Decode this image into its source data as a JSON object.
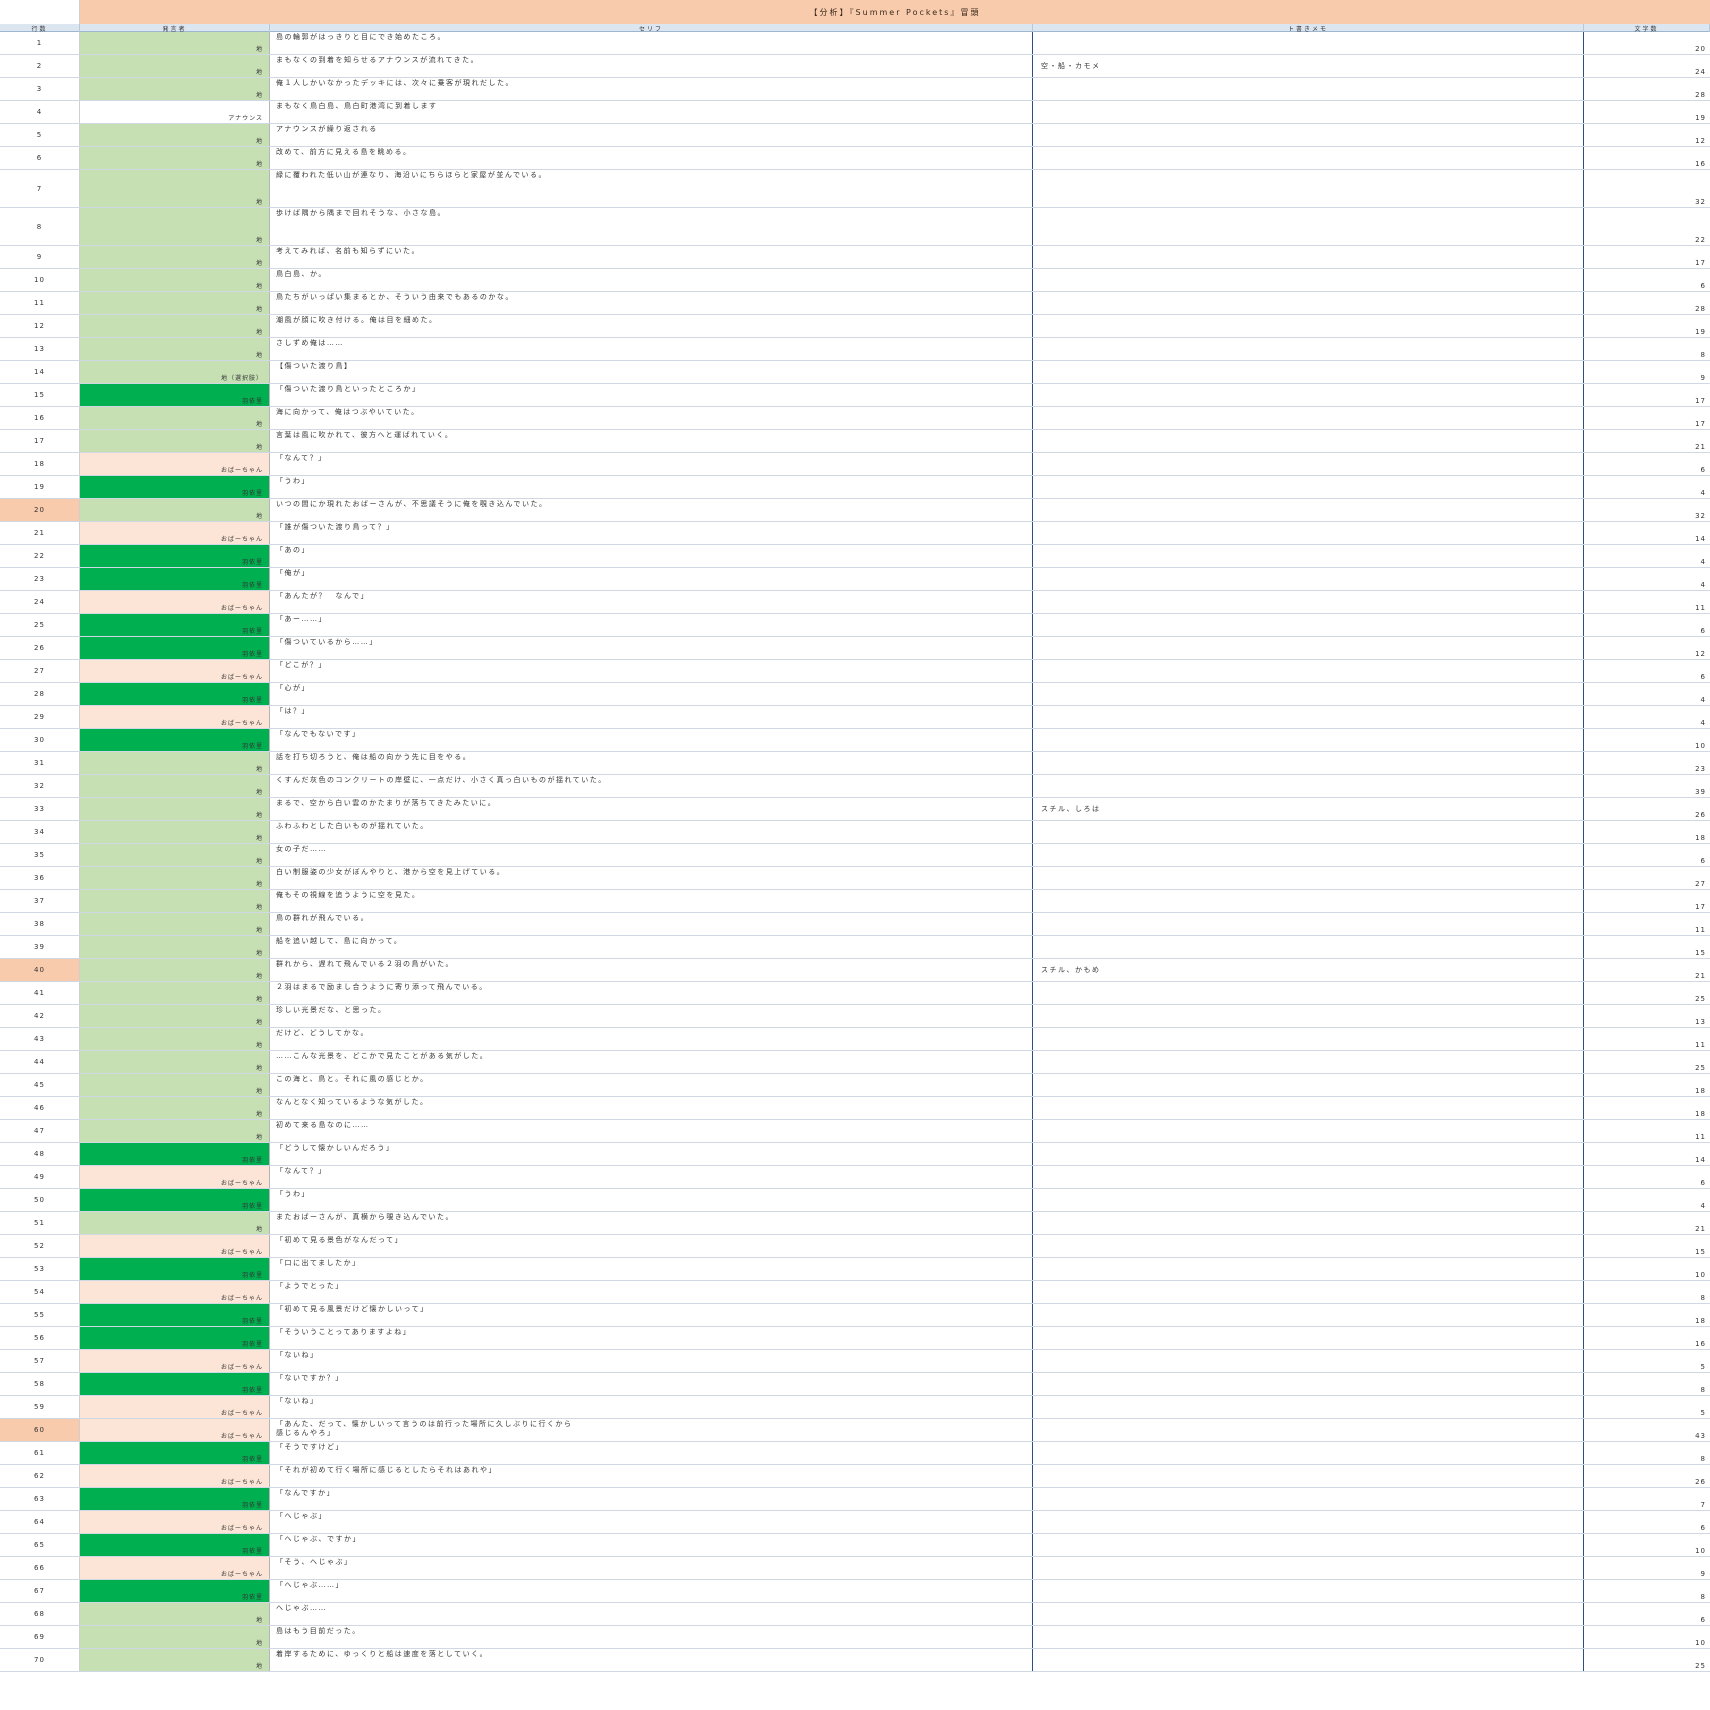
{
  "sheet": {
    "title": "【分析】『Summer Pockets』冒頭",
    "headers": {
      "num": "行数",
      "speaker": "発言者",
      "line": "セリフ",
      "memo": "ト書きメモ",
      "count": "文字数"
    }
  },
  "colors": {
    "narrator": "#c6e0b4",
    "hero": "#00b050",
    "grandma": "#fce4d6",
    "highlight": "#f8cbad"
  },
  "rows": [
    {
      "n": "1",
      "speaker": "地",
      "type": "narr",
      "line": "島の輪郭がはっきりと目にでき始めたころ。",
      "memo": "",
      "count": "20"
    },
    {
      "n": "2",
      "speaker": "地",
      "type": "narr",
      "line": "まもなくの到着を知らせるアナウンスが流れてきた。",
      "memo": "空・船・カモメ",
      "count": "24"
    },
    {
      "n": "3",
      "speaker": "地",
      "type": "narr",
      "line": "俺１人しかいなかったデッキには、次々に乗客が現れだした。",
      "memo": "",
      "count": "28"
    },
    {
      "n": "4",
      "speaker": "アナウンス",
      "type": "other",
      "line": "まもなく鳥白島、鳥白町港湾に到着します",
      "memo": "",
      "count": "19"
    },
    {
      "n": "5",
      "speaker": "地",
      "type": "narr",
      "line": "アナウンスが繰り返される",
      "memo": "",
      "count": "12"
    },
    {
      "n": "6",
      "speaker": "地",
      "type": "narr",
      "line": "改めて、前方に見える島を眺める。",
      "memo": "",
      "count": "16"
    },
    {
      "n": "7",
      "speaker": "地",
      "type": "narr",
      "line": "緑に覆われた低い山が連なり、海沿いにちらほらと家屋が並んでいる。",
      "memo": "",
      "count": "32"
    },
    {
      "n": "8",
      "speaker": "地",
      "type": "narr",
      "line": "歩けば隅から隅まで回れそうな、小さな島。",
      "memo": "",
      "count": "22"
    },
    {
      "n": "9",
      "speaker": "地",
      "type": "narr",
      "line": "考えてみれば、名前も知らずにいた。",
      "memo": "",
      "count": "17"
    },
    {
      "n": "10",
      "speaker": "地",
      "type": "narr",
      "line": "鳥白島、か。",
      "memo": "",
      "count": "6"
    },
    {
      "n": "11",
      "speaker": "地",
      "type": "narr",
      "line": "鳥たちがいっぱい集まるとか、そういう由来でもあるのかな。",
      "memo": "",
      "count": "28"
    },
    {
      "n": "12",
      "speaker": "地",
      "type": "narr",
      "line": "潮風が顔に吹き付ける。俺は目を細めた。",
      "memo": "",
      "count": "19"
    },
    {
      "n": "13",
      "speaker": "地",
      "type": "narr",
      "line": "さしずめ俺は……",
      "memo": "",
      "count": "8"
    },
    {
      "n": "14",
      "speaker": "地（選択肢）",
      "type": "narr",
      "line": "【傷ついた渡り鳥】",
      "memo": "",
      "count": "9"
    },
    {
      "n": "15",
      "speaker": "羽依里",
      "type": "hero",
      "line": "「傷ついた渡り鳥といったところか」",
      "memo": "",
      "count": "17"
    },
    {
      "n": "16",
      "speaker": "地",
      "type": "narr",
      "line": "海に向かって、俺はつぶやいていた。",
      "memo": "",
      "count": "17"
    },
    {
      "n": "17",
      "speaker": "地",
      "type": "narr",
      "line": "言葉は風に吹かれて、彼方へと運ばれていく。",
      "memo": "",
      "count": "21"
    },
    {
      "n": "18",
      "speaker": "おばーちゃん",
      "type": "grandma",
      "line": "「なんて？」",
      "memo": "",
      "count": "6"
    },
    {
      "n": "19",
      "speaker": "羽依里",
      "type": "hero",
      "line": "「うわ」",
      "memo": "",
      "count": "4"
    },
    {
      "n": "20",
      "speaker": "地",
      "type": "narr",
      "line": "いつの間にか現れたおばーさんが、不思議そうに俺を覗き込んでいた。",
      "memo": "",
      "count": "32",
      "hl": true
    },
    {
      "n": "21",
      "speaker": "おばーちゃん",
      "type": "grandma",
      "line": "「誰が傷ついた渡り鳥って？」",
      "memo": "",
      "count": "14"
    },
    {
      "n": "22",
      "speaker": "羽依里",
      "type": "hero",
      "line": "「あの」",
      "memo": "",
      "count": "4"
    },
    {
      "n": "23",
      "speaker": "羽依里",
      "type": "hero",
      "line": "「俺が」",
      "memo": "",
      "count": "4"
    },
    {
      "n": "24",
      "speaker": "おばーちゃん",
      "type": "grandma",
      "line": "「あんたが？　なんで」",
      "memo": "",
      "count": "11"
    },
    {
      "n": "25",
      "speaker": "羽依里",
      "type": "hero",
      "line": "「あー……」",
      "memo": "",
      "count": "6"
    },
    {
      "n": "26",
      "speaker": "羽依里",
      "type": "hero",
      "line": "「傷ついているから……」",
      "memo": "",
      "count": "12"
    },
    {
      "n": "27",
      "speaker": "おばーちゃん",
      "type": "grandma",
      "line": "「どこが？」",
      "memo": "",
      "count": "6"
    },
    {
      "n": "28",
      "speaker": "羽依里",
      "type": "hero",
      "line": "「心が」",
      "memo": "",
      "count": "4"
    },
    {
      "n": "29",
      "speaker": "おばーちゃん",
      "type": "grandma",
      "line": "「は？」",
      "memo": "",
      "count": "4"
    },
    {
      "n": "30",
      "speaker": "羽依里",
      "type": "hero",
      "line": "「なんでもないです」",
      "memo": "",
      "count": "10"
    },
    {
      "n": "31",
      "speaker": "地",
      "type": "narr",
      "line": "話を打ち切ろうと、俺は船の向かう先に目をやる。",
      "memo": "",
      "count": "23"
    },
    {
      "n": "32",
      "speaker": "地",
      "type": "narr",
      "line": "くすんだ灰色のコンクリートの岸壁に、一点だけ、小さく真っ白いものが揺れていた。",
      "memo": "",
      "count": "39"
    },
    {
      "n": "33",
      "speaker": "地",
      "type": "narr",
      "line": "まるで、空から白い雲のかたまりが落ちてきたみたいに。",
      "memo": "スチル、しろは",
      "count": "26"
    },
    {
      "n": "34",
      "speaker": "地",
      "type": "narr",
      "line": "ふわふわとした白いものが揺れていた。",
      "memo": "",
      "count": "18"
    },
    {
      "n": "35",
      "speaker": "地",
      "type": "narr",
      "line": "女の子だ……",
      "memo": "",
      "count": "6"
    },
    {
      "n": "36",
      "speaker": "地",
      "type": "narr",
      "line": "白い制服姿の少女がぼんやりと、港から空を見上げている。",
      "memo": "",
      "count": "27"
    },
    {
      "n": "37",
      "speaker": "地",
      "type": "narr",
      "line": "俺もその視線を追うように空を見た。",
      "memo": "",
      "count": "17"
    },
    {
      "n": "38",
      "speaker": "地",
      "type": "narr",
      "line": "鳥の群れが飛んでいる。",
      "memo": "",
      "count": "11"
    },
    {
      "n": "39",
      "speaker": "地",
      "type": "narr",
      "line": "船を追い越して、島に向かって。",
      "memo": "",
      "count": "15"
    },
    {
      "n": "40",
      "speaker": "地",
      "type": "narr",
      "line": "群れから、遅れて飛んでいる２羽の鳥がいた。",
      "memo": "スチル、かもめ",
      "count": "21",
      "hl": true
    },
    {
      "n": "41",
      "speaker": "地",
      "type": "narr",
      "line": "２羽はまるで励まし合うように寄り添って飛んでいる。",
      "memo": "",
      "count": "25"
    },
    {
      "n": "42",
      "speaker": "地",
      "type": "narr",
      "line": "珍しい光景だな、と思った。",
      "memo": "",
      "count": "13"
    },
    {
      "n": "43",
      "speaker": "地",
      "type": "narr",
      "line": "だけど、どうしてかな。",
      "memo": "",
      "count": "11"
    },
    {
      "n": "44",
      "speaker": "地",
      "type": "narr",
      "line": "……こんな光景を、どこかで見たことがある気がした。",
      "memo": "",
      "count": "25"
    },
    {
      "n": "45",
      "speaker": "地",
      "type": "narr",
      "line": "この海と、鳥と。それに風の感じとか。",
      "memo": "",
      "count": "18"
    },
    {
      "n": "46",
      "speaker": "地",
      "type": "narr",
      "line": "なんとなく知っているような気がした。",
      "memo": "",
      "count": "18"
    },
    {
      "n": "47",
      "speaker": "地",
      "type": "narr",
      "line": "初めて来る島なのに……",
      "memo": "",
      "count": "11"
    },
    {
      "n": "48",
      "speaker": "羽依里",
      "type": "hero",
      "line": "「どうして懐かしいんだろう」",
      "memo": "",
      "count": "14"
    },
    {
      "n": "49",
      "speaker": "おばーちゃん",
      "type": "grandma",
      "line": "「なんて？」",
      "memo": "",
      "count": "6"
    },
    {
      "n": "50",
      "speaker": "羽依里",
      "type": "hero",
      "line": "「うわ」",
      "memo": "",
      "count": "4"
    },
    {
      "n": "51",
      "speaker": "地",
      "type": "narr",
      "line": "またおばーさんが、真横から覗き込んでいた。",
      "memo": "",
      "count": "21"
    },
    {
      "n": "52",
      "speaker": "おばーちゃん",
      "type": "grandma",
      "line": "「初めて見る景色がなんだって」",
      "memo": "",
      "count": "15"
    },
    {
      "n": "53",
      "speaker": "羽依里",
      "type": "hero",
      "line": "「口に出てましたか」",
      "memo": "",
      "count": "10"
    },
    {
      "n": "54",
      "speaker": "おばーちゃん",
      "type": "grandma",
      "line": "「ようでとった」",
      "memo": "",
      "count": "8"
    },
    {
      "n": "55",
      "speaker": "羽依里",
      "type": "hero",
      "line": "「初めて見る風景だけど懐かしいって」",
      "memo": "",
      "count": "18"
    },
    {
      "n": "56",
      "speaker": "羽依里",
      "type": "hero",
      "line": "「そういうことってありますよね」",
      "memo": "",
      "count": "16"
    },
    {
      "n": "57",
      "speaker": "おばーちゃん",
      "type": "grandma",
      "line": "「ないね」",
      "memo": "",
      "count": "5"
    },
    {
      "n": "58",
      "speaker": "羽依里",
      "type": "hero",
      "line": "「ないですか？」",
      "memo": "",
      "count": "8"
    },
    {
      "n": "59",
      "speaker": "おばーちゃん",
      "type": "grandma",
      "line": "「ないね」",
      "memo": "",
      "count": "5"
    },
    {
      "n": "60",
      "speaker": "おばーちゃん",
      "type": "grandma",
      "line": "「あんた、だって、懐かしいって言うのは前行った場所に久しぶりに行くから\n感じるんやろ」",
      "memo": "",
      "count": "43",
      "hl": true
    },
    {
      "n": "61",
      "speaker": "羽依里",
      "type": "hero",
      "line": "「そうですけど」",
      "memo": "",
      "count": "8"
    },
    {
      "n": "62",
      "speaker": "おばーちゃん",
      "type": "grandma",
      "line": "「それが初めて行く場所に感じるとしたらそれはあれや」",
      "memo": "",
      "count": "26"
    },
    {
      "n": "63",
      "speaker": "羽依里",
      "type": "hero",
      "line": "「なんですか」",
      "memo": "",
      "count": "7"
    },
    {
      "n": "64",
      "speaker": "おばーちゃん",
      "type": "grandma",
      "line": "「へじゃぶ」",
      "memo": "",
      "count": "6"
    },
    {
      "n": "65",
      "speaker": "羽依里",
      "type": "hero",
      "line": "「へじゃぶ、ですか」",
      "memo": "",
      "count": "10"
    },
    {
      "n": "66",
      "speaker": "おばーちゃん",
      "type": "grandma",
      "line": "「そう、へじゃぶ」",
      "memo": "",
      "count": "9"
    },
    {
      "n": "67",
      "speaker": "羽依里",
      "type": "hero",
      "line": "「へじゃぶ……」",
      "memo": "",
      "count": "8"
    },
    {
      "n": "68",
      "speaker": "地",
      "type": "narr",
      "line": "へじゃぶ……",
      "memo": "",
      "count": "6"
    },
    {
      "n": "69",
      "speaker": "地",
      "type": "narr",
      "line": "島はもう目前だった。",
      "memo": "",
      "count": "10"
    },
    {
      "n": "70",
      "speaker": "地",
      "type": "narr",
      "line": "着岸するために、ゆっくりと船は速度を落としていく。",
      "memo": "",
      "count": "25"
    }
  ]
}
